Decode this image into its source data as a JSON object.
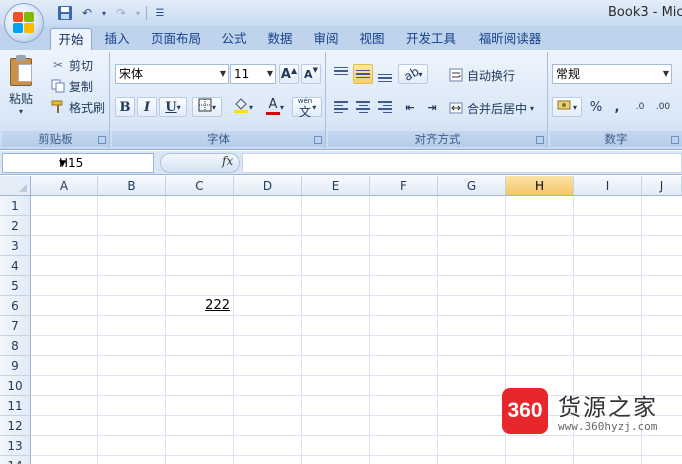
{
  "window": {
    "title": "Book3 - Mic"
  },
  "tabs": [
    {
      "label": "开始",
      "active": true
    },
    {
      "label": "插入"
    },
    {
      "label": "页面布局"
    },
    {
      "label": "公式"
    },
    {
      "label": "数据"
    },
    {
      "label": "审阅"
    },
    {
      "label": "视图"
    },
    {
      "label": "开发工具"
    },
    {
      "label": "福昕阅读器"
    }
  ],
  "clipboard": {
    "group_label": "剪贴板",
    "paste_label": "粘贴",
    "cut_label": "剪切",
    "copy_label": "复制",
    "format_painter_label": "格式刷"
  },
  "font": {
    "group_label": "字体",
    "font_name": "宋体",
    "font_size": "11",
    "bold": "B",
    "italic": "I",
    "underline": "U",
    "font_color_letter": "A",
    "phonetic_letter": "wén",
    "phonetic_char": "文",
    "grow_letter": "A",
    "shrink_letter": "A"
  },
  "alignment": {
    "group_label": "对齐方式",
    "wrap_text_label": "自动换行",
    "merge_center_label": "合并后居中"
  },
  "number": {
    "group_label": "数字",
    "format": "常规",
    "percent": "%",
    "comma": ",",
    "increase_decimal": ".0",
    "decrease_decimal": ".00"
  },
  "formula_bar": {
    "name_box": "H15",
    "fx": "fx",
    "formula": ""
  },
  "sheet": {
    "columns": [
      "A",
      "B",
      "C",
      "D",
      "E",
      "F",
      "G",
      "H",
      "I",
      "J"
    ],
    "active_column": "H",
    "rows": [
      "1",
      "2",
      "3",
      "4",
      "5",
      "6",
      "7",
      "8",
      "9",
      "10",
      "11",
      "12",
      "13",
      "14"
    ],
    "cells": {
      "C6": "222"
    }
  },
  "watermark": {
    "logo": "360",
    "name": "货源之家",
    "url": "www.360hyzj.com"
  },
  "colors": {
    "ribbon_bg": "#dbe7f7",
    "active_header": "#f6c667",
    "watermark_red": "#e8272d"
  }
}
